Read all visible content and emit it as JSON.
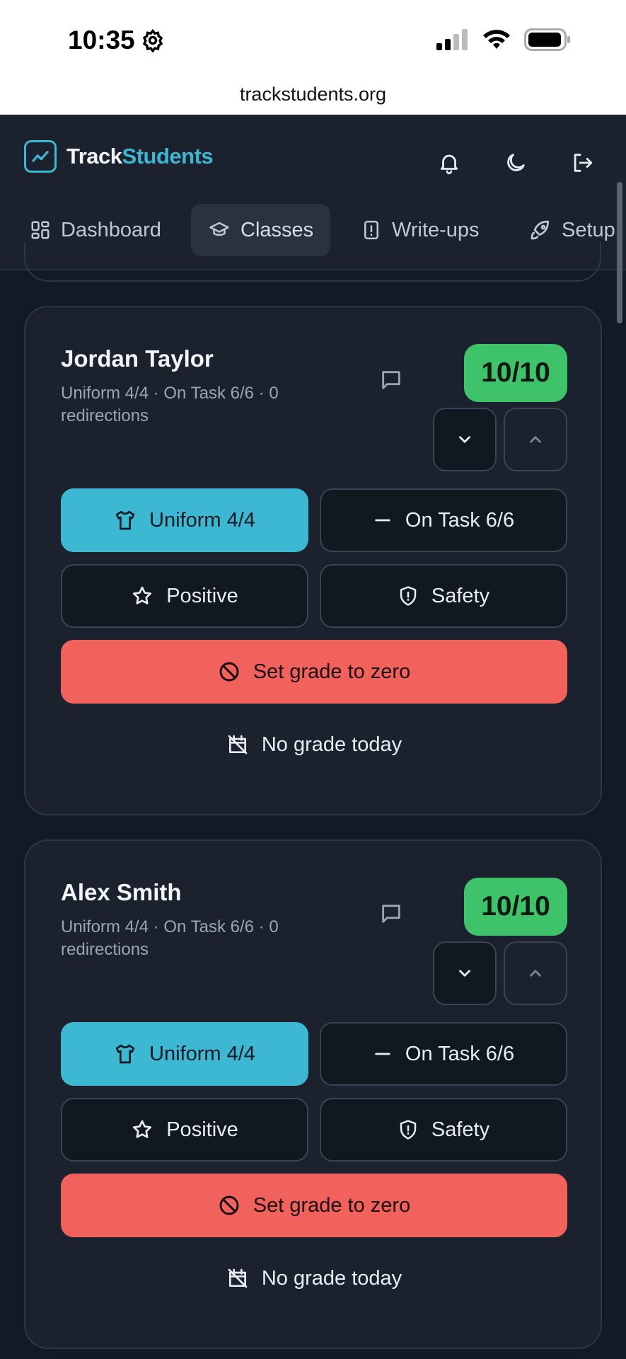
{
  "status": {
    "time": "10:35"
  },
  "browser": {
    "url": "trackstudents.org"
  },
  "app": {
    "brand_part1": "Track",
    "brand_part2": "Students",
    "accent_color": "#3cb8d3",
    "header_icons": [
      "bell-icon",
      "moon-icon",
      "logout-icon"
    ]
  },
  "nav": {
    "items": [
      {
        "label": "Dashboard",
        "icon": "dashboard-icon"
      },
      {
        "label": "Classes",
        "icon": "graduation-cap-icon",
        "active": true
      },
      {
        "label": "Write-ups",
        "icon": "alert-file-icon"
      },
      {
        "label": "Setup",
        "icon": "rocket-icon"
      }
    ]
  },
  "students": [
    {
      "name": "Jordan Taylor",
      "meta": "Uniform 4/4 · On Task 6/6 · 0 redirections",
      "grade": "10/10",
      "buttons": {
        "uniform": "Uniform 4/4",
        "on_task": "On Task 6/6",
        "positive": "Positive",
        "safety": "Safety",
        "zero": "Set grade to zero",
        "no_grade": "No grade today"
      }
    },
    {
      "name": "Alex Smith",
      "meta": "Uniform 4/4 · On Task 6/6 · 0 redirections",
      "grade": "10/10",
      "buttons": {
        "uniform": "Uniform 4/4",
        "on_task": "On Task 6/6",
        "positive": "Positive",
        "safety": "Safety",
        "zero": "Set grade to zero",
        "no_grade": "No grade today"
      }
    }
  ],
  "colors": {
    "grade_badge": "#3ec26a",
    "uniform_active": "#3cb8d3",
    "zero_button": "#f2625c"
  }
}
